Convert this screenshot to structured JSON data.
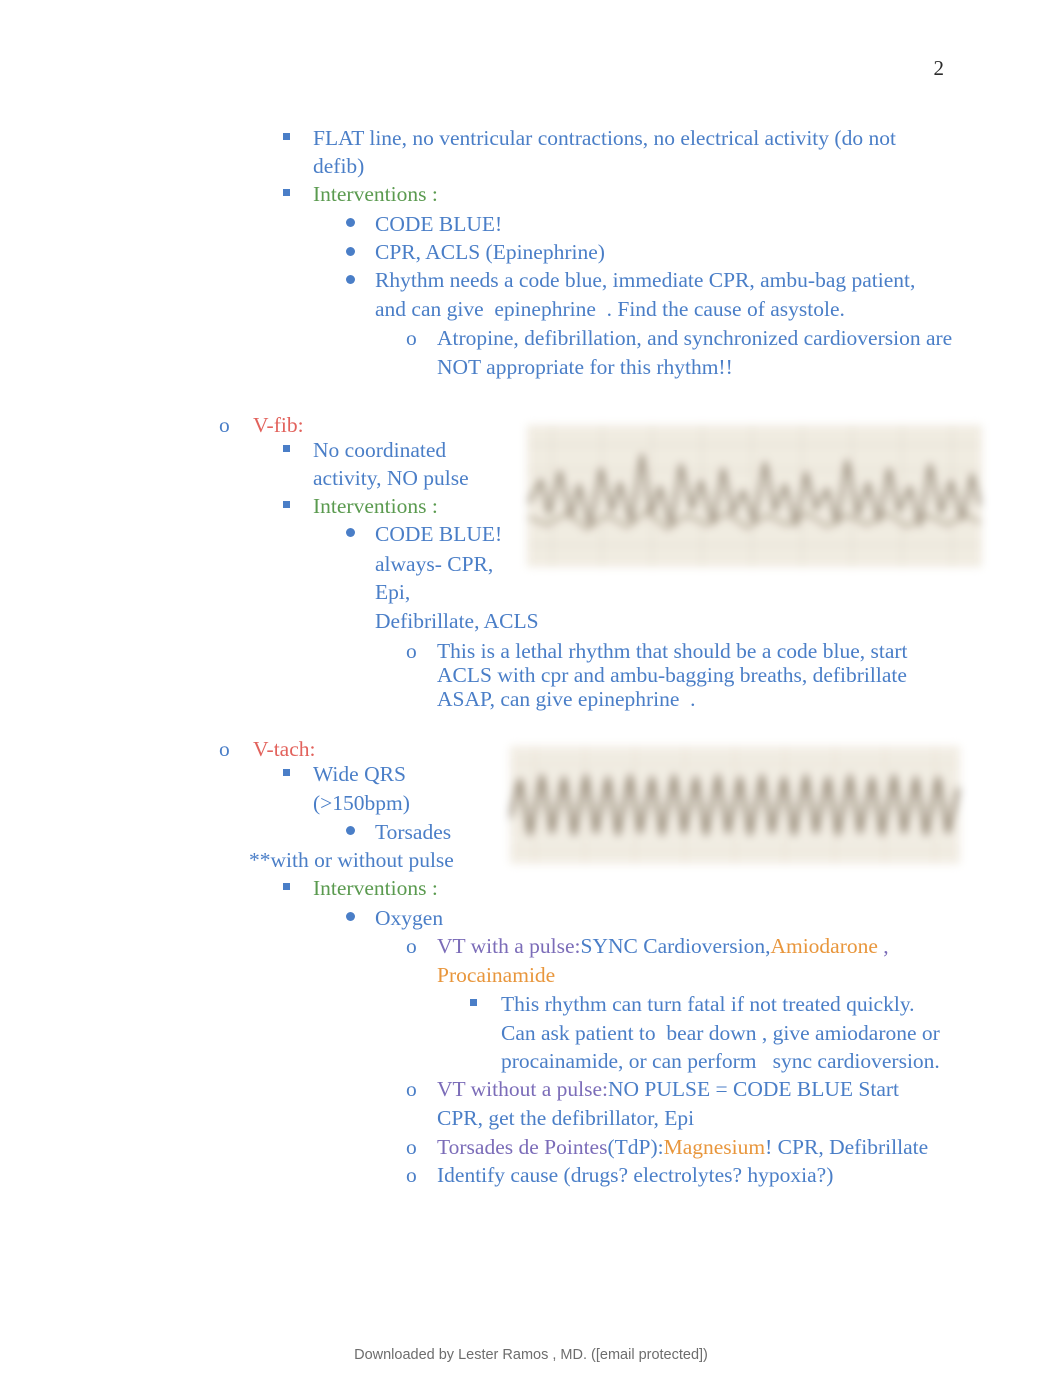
{
  "document": {
    "page_number": "2",
    "footer": "Downloaded by Lester Ramos , MD. ([email protected])"
  },
  "colors": {
    "blue": "#4a7ec7",
    "green": "#5a9a4f",
    "red": "#e2625c",
    "purple": "#7b6cb8",
    "orange": "#e8963c",
    "page_number": "#2b2b2b",
    "footer": "#6d6d6d",
    "ecg_paper": "#efe9dd",
    "ecg_trace": "#9c8f7c"
  },
  "asystole_section": {
    "flat_line_l1": "FLAT line, no ventricular contractions, no electrical activity (do not",
    "flat_line_l2": "defib)",
    "interventions_label": "Interventions :",
    "code_blue": "CODE BLUE!",
    "cpr_acls": "CPR, ACLS (Epinephrine)",
    "rhythm_l1": "Rhythm needs a code blue, immediate CPR, ambu-bag patient,",
    "rhythm_l2": "and can give  epinephrine  . Find the cause of asystole.",
    "atropine_l1": "Atropine, defibrillation, and synchronized cardioversion are",
    "atropine_l2": "NOT appropriate for this rhythm!!"
  },
  "vfib_section": {
    "heading": "V-fib:",
    "no_coord_l1": "No coordinated",
    "no_coord_l2": "activity, NO pulse",
    "interventions_label": "Interventions :",
    "code_blue": "CODE BLUE!",
    "always_cpr": "always- CPR,",
    "epi": "Epi,",
    "defib_acls": "Defibrillate, ACLS",
    "lethal_l1": "This is a lethal rhythm that should be a code blue, start",
    "lethal_l2": "ACLS with cpr and ambu-bagging breaths, defibrillate",
    "lethal_l3": "ASAP, can give epinephrine  ."
  },
  "vtach_section": {
    "heading": "V-tach:",
    "wide_qrs_l1": "Wide QRS",
    "wide_qrs_l2": "(>150bpm)",
    "torsades": "Torsades",
    "with_or_without_pulse": "**with or without pulse",
    "interventions_label": "Interventions :",
    "oxygen": "Oxygen",
    "vt_with_pulse": {
      "lead": "VT with a pulse:",
      "sync": "SYNC Cardioversion,",
      "amiodarone": "Amiodarone",
      "comma": " ,",
      "procainamide": "Procainamide"
    },
    "fatal_note": {
      "l1": "This rhythm can turn fatal if not treated quickly.",
      "l2": "Can ask patient to  bear down , give amiodarone or",
      "l3": "procainamide, or can perform   sync cardioversion."
    },
    "vt_without_pulse": {
      "lead": "VT without a pulse:",
      "detail_l1": "NO PULSE = CODE BLUE Start",
      "detail_l2": "CPR, get the defibrillator, Epi"
    },
    "torsades_de_pointes": {
      "lead": "Torsades de Pointes",
      "tdp": "(TdP):",
      "magnesium": "Magnesium",
      "tail": "! CPR, Defibrillate"
    },
    "identify_cause": "Identify cause (drugs? electrolytes? hypoxia?)"
  },
  "markers": {
    "o": "o"
  },
  "images": {
    "vfib_ecg_alt": "ventricular-fibrillation-ecg-strip",
    "vtach_ecg_alt": "ventricular-tachycardia-ecg-strip"
  }
}
